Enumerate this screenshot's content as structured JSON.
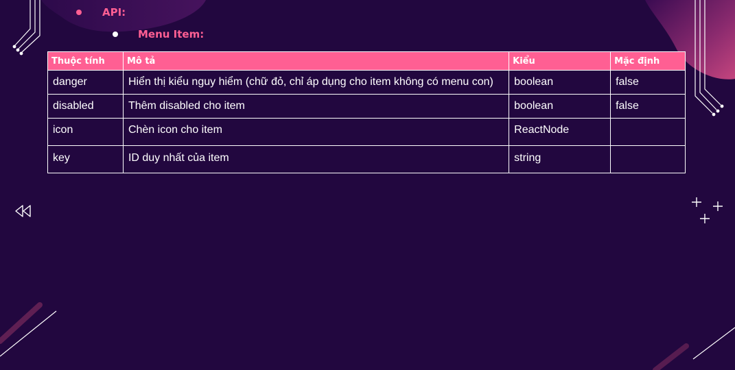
{
  "slide": {
    "api_heading": "API:",
    "sub_heading": "Menu Item:"
  },
  "table": {
    "headers": [
      "Thuộc tính",
      "Mô tả",
      "Kiểu",
      "Mặc định"
    ],
    "rows": [
      [
        "danger",
        "Hiển thị kiểu nguy hiểm (chữ đỏ, chỉ áp dụng cho item không có menu con)",
        "boolean",
        "false"
      ],
      [
        "disabled",
        "Thêm disabled cho item",
        "boolean",
        "false"
      ],
      [
        "icon",
        "Chèn icon cho item",
        "ReactNode",
        ""
      ],
      [
        "key",
        "ID duy nhất của item",
        "string",
        ""
      ]
    ]
  },
  "colors": {
    "background": "#22073f",
    "accent": "#ff5f93",
    "text": "#ffffff"
  },
  "icons": {
    "nav": "rewind-icon",
    "sparkles": "plus-sparkle-icon"
  }
}
